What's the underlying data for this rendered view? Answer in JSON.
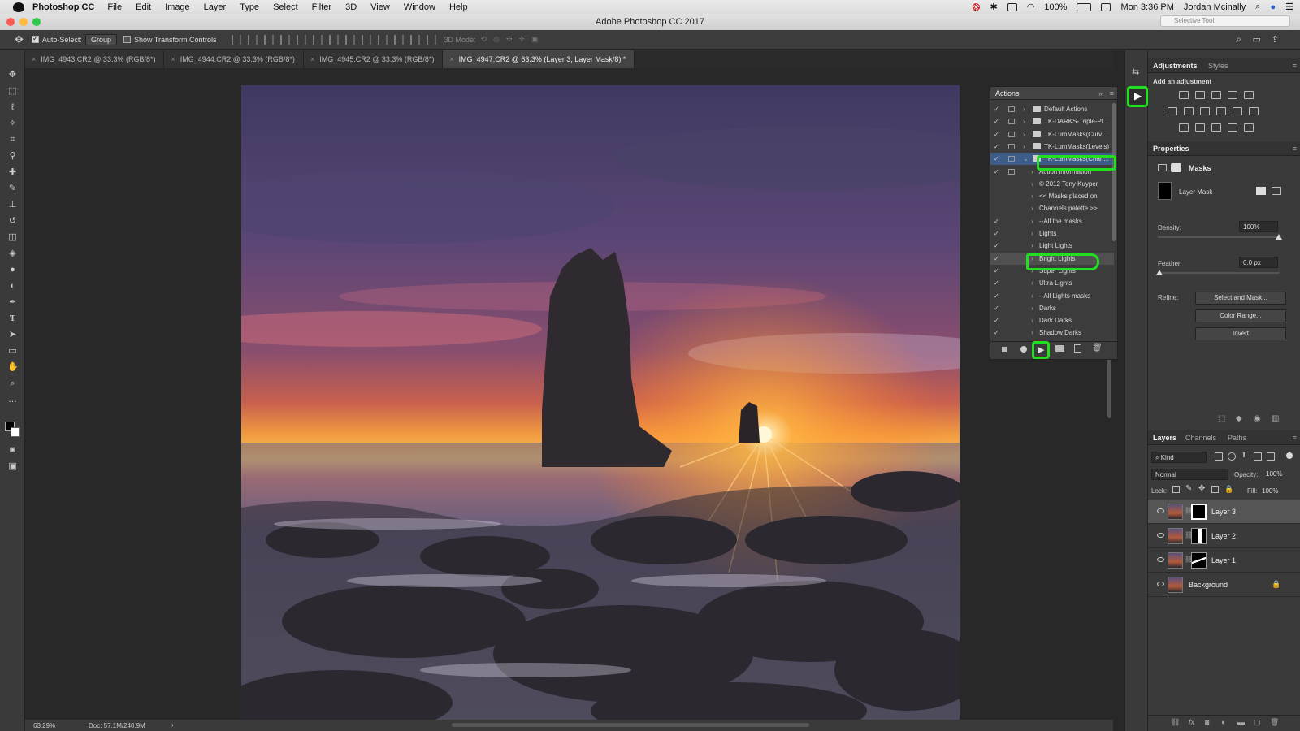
{
  "menubar": {
    "app_name": "Photoshop CC",
    "items": [
      "File",
      "Edit",
      "Image",
      "Layer",
      "Type",
      "Select",
      "Filter",
      "3D",
      "View",
      "Window",
      "Help"
    ],
    "battery": "100%",
    "clock": "Mon 3:36 PM",
    "user": "Jordan Mcinally"
  },
  "window": {
    "title": "Adobe Photoshop CC 2017",
    "search_placeholder": "Selective Tool"
  },
  "options_bar": {
    "auto_select_label": "Auto-Select:",
    "auto_select_value": "Group",
    "show_transform_label": "Show Transform Controls",
    "mode_3d_label": "3D Mode:"
  },
  "tabs": [
    {
      "label": "IMG_4943.CR2 @ 33.3% (RGB/8*)"
    },
    {
      "label": "IMG_4944.CR2 @ 33.3% (RGB/8*)"
    },
    {
      "label": "IMG_4945.CR2 @ 33.3% (RGB/8*)"
    },
    {
      "label": "IMG_4947.CR2 @ 63.3% (Layer 3, Layer Mask/8) *"
    }
  ],
  "status": {
    "zoom": "63.29%",
    "doc": "Doc: 57.1M/240.9M"
  },
  "actions_panel": {
    "title": "Actions",
    "rows": [
      {
        "label": "Default Actions"
      },
      {
        "label": "TK-DARKS-Triple-Pl..."
      },
      {
        "label": "TK-LumMasks(Curv..."
      },
      {
        "label": "TK-LumMasks(Levels)"
      },
      {
        "label": "TK-LumMasks(Chan..."
      },
      {
        "label": "Action information"
      },
      {
        "label": "© 2012 Tony Kuyper"
      },
      {
        "label": "<< Masks placed on"
      },
      {
        "label": "Channels palette >>"
      },
      {
        "label": "--All the masks"
      },
      {
        "label": "Lights"
      },
      {
        "label": "Light Lights"
      },
      {
        "label": "Bright Lights"
      },
      {
        "label": "Super Lights"
      },
      {
        "label": "Ultra Lights"
      },
      {
        "label": "--All Lights masks"
      },
      {
        "label": "Darks"
      },
      {
        "label": "Dark Darks"
      },
      {
        "label": "Shadow Darks"
      }
    ]
  },
  "adjustments_panel": {
    "tab_active": "Adjustments",
    "tab_other": "Styles",
    "subtitle": "Add an adjustment"
  },
  "properties_panel": {
    "title": "Properties",
    "masks_label": "Masks",
    "layer_mask_label": "Layer Mask",
    "density_label": "Density:",
    "density_value": "100%",
    "feather_label": "Feather:",
    "feather_value": "0.0 px",
    "refine_label": "Refine:",
    "select_mask_button": "Select and Mask...",
    "color_range_button": "Color Range...",
    "invert_button": "Invert"
  },
  "layers_panel": {
    "tab_active": "Layers",
    "tab_channels": "Channels",
    "tab_paths": "Paths",
    "filter_kind": "Kind",
    "blend_mode": "Normal",
    "opacity_label": "Opacity:",
    "opacity_value": "100%",
    "lock_label": "Lock:",
    "fill_label": "Fill:",
    "fill_value": "100%",
    "layers": [
      {
        "name": "Layer 3"
      },
      {
        "name": "Layer 2"
      },
      {
        "name": "Layer 1"
      },
      {
        "name": "Background"
      }
    ]
  },
  "colors": {
    "highlight": "#20e020",
    "panel_bg": "#3c3c3c"
  }
}
